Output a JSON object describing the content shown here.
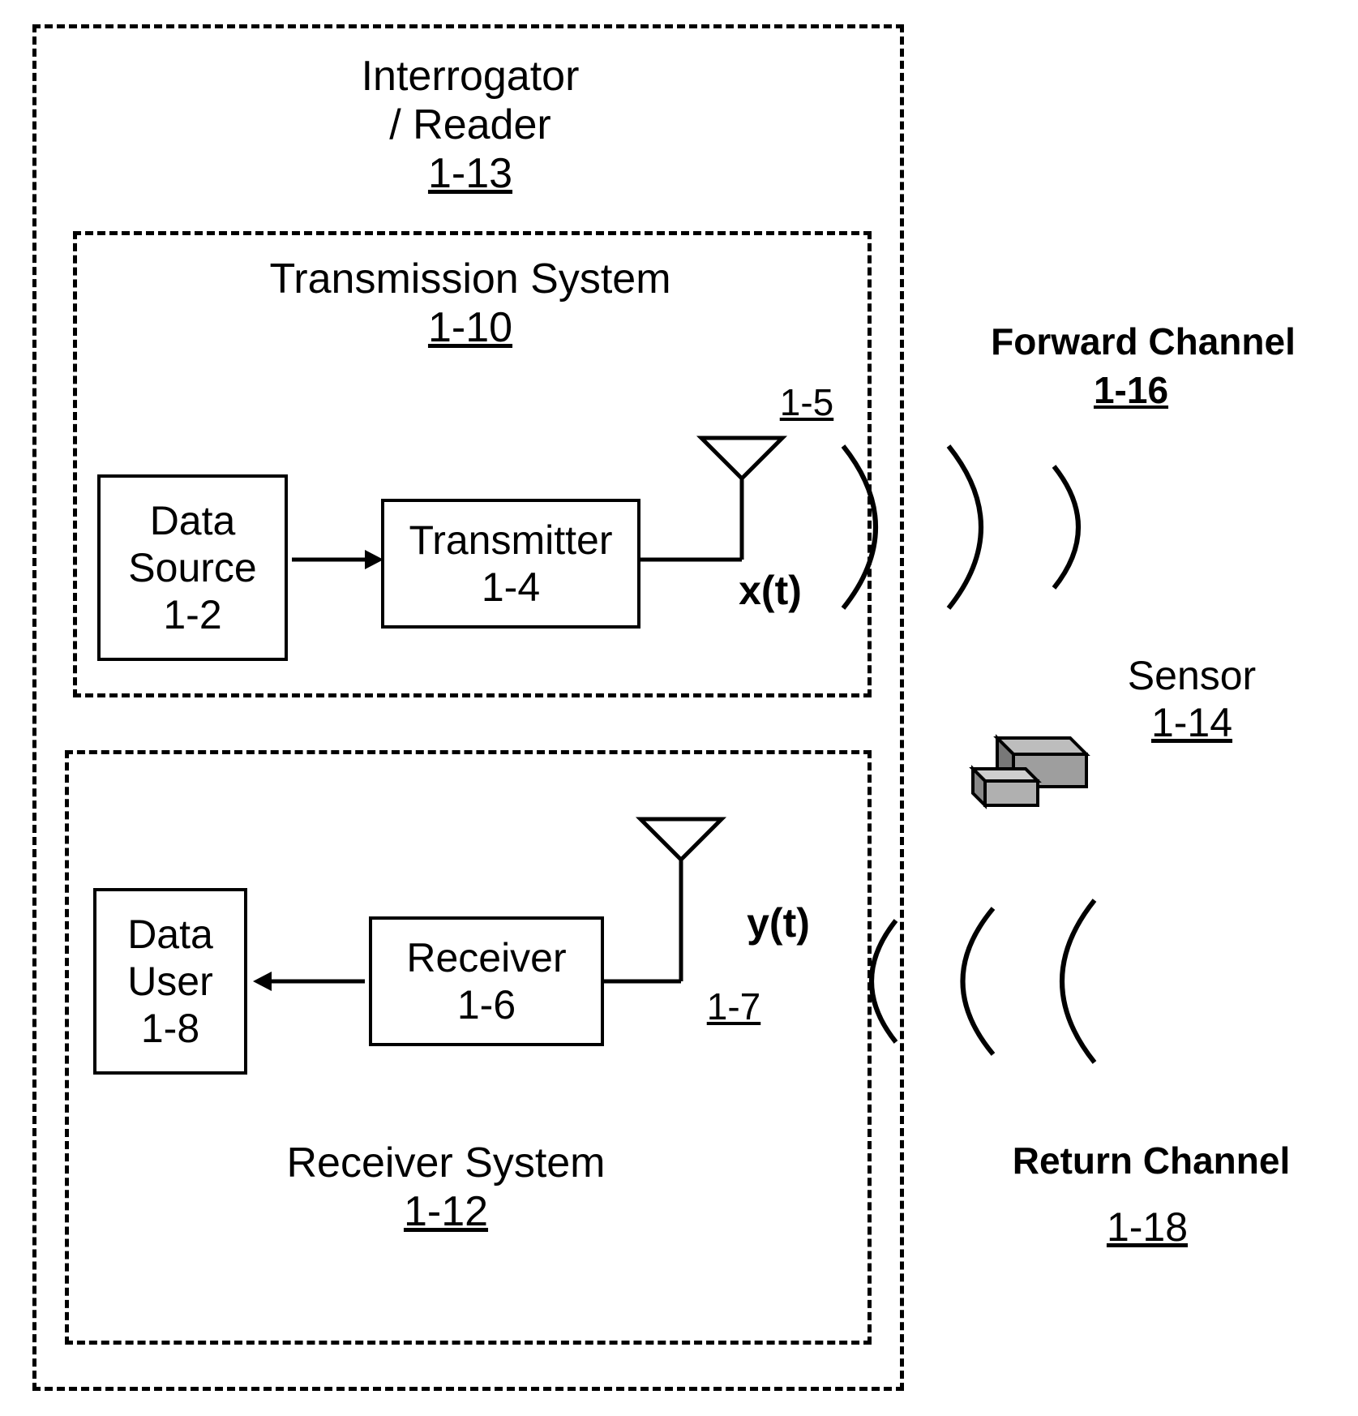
{
  "interrogator": {
    "title_line1": "Interrogator",
    "title_line2": "/ Reader",
    "ref": "1-13"
  },
  "transmission": {
    "title": "Transmission System",
    "ref": "1-10",
    "data_source": {
      "line1": "Data",
      "line2": "Source",
      "ref": "1-2"
    },
    "transmitter": {
      "label": "Transmitter",
      "ref": "1-4"
    },
    "antenna_ref": "1-5",
    "signal": "x(t)"
  },
  "receiver_sys": {
    "title": "Receiver System",
    "ref": "1-12",
    "data_user": {
      "line1": "Data",
      "line2": "User",
      "ref": "1-8"
    },
    "receiver": {
      "label": "Receiver",
      "ref": "1-6"
    },
    "antenna_ref": "1-7",
    "signal": "y(t)"
  },
  "forward_channel": {
    "label": "Forward Channel",
    "ref": "1-16"
  },
  "return_channel": {
    "label": "Return Channel",
    "ref": "1-18"
  },
  "sensor": {
    "label": "Sensor",
    "ref": "1-14"
  }
}
